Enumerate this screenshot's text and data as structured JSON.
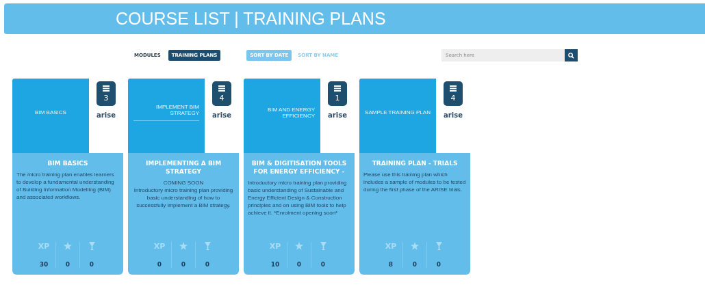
{
  "header": {
    "title": "COURSE LIST | TRAINING PLANS"
  },
  "view_tabs": [
    {
      "label": "MODULES",
      "selected": false
    },
    {
      "label": "TRAINING PLANS",
      "selected": true
    }
  ],
  "sort_tabs": [
    {
      "label": "SORT BY DATE",
      "selected": true
    },
    {
      "label": "SORT BY NAME",
      "selected": false
    }
  ],
  "search": {
    "placeholder": "Search here"
  },
  "cards": [
    {
      "thumbnail_title": "BIM BASICS",
      "module_count": "3",
      "logo": "arise",
      "title": "BIM BASICS",
      "description": "The micro training plan enables learners to develop a fundamental understanding of Building Information Modelling (BIM) and associated workflows.",
      "xp": "30",
      "stars": "0",
      "trophies": "0",
      "labels": [
        "XP"
      ]
    },
    {
      "thumbnail_title": "IMPLEMENT BIM STRATEGY",
      "module_count": "4",
      "logo": "arise",
      "title": "IMPLEMENTING A BIM STRATEGY",
      "subtitle": "COMING SOON",
      "description": "Introductory micro training plan providing basic understanding of how to successfully implement a BIM strategy.",
      "xp": "0",
      "stars": "0",
      "trophies": "0",
      "labels": [
        "XP"
      ]
    },
    {
      "thumbnail_title": "BIM AND ENERGY EFFICIENCY",
      "module_count": "1",
      "logo": "arise",
      "title": "BIM & DIGITISATION TOOLS FOR ENERGY EFFICIENCY -",
      "description": "Introductory micro training plan providing basic understanding of Sustainable and Energy Efficient Design & Construction principles and on using BIM tools to help achieve it. *Enrolment opening soon*",
      "xp": "10",
      "stars": "0",
      "trophies": "0",
      "labels": [
        "XP"
      ]
    },
    {
      "thumbnail_title": "SAMPLE TRAINING PLAN",
      "module_count": "4",
      "logo": "arise",
      "title": "TRAINING PLAN - TRIALS",
      "description": "Please use this training plan which includes a sample of modules to be tested during the first phase of the ARISE trials.",
      "xp": "8",
      "stars": "0",
      "trophies": "0",
      "labels": [
        "XP"
      ]
    }
  ]
}
